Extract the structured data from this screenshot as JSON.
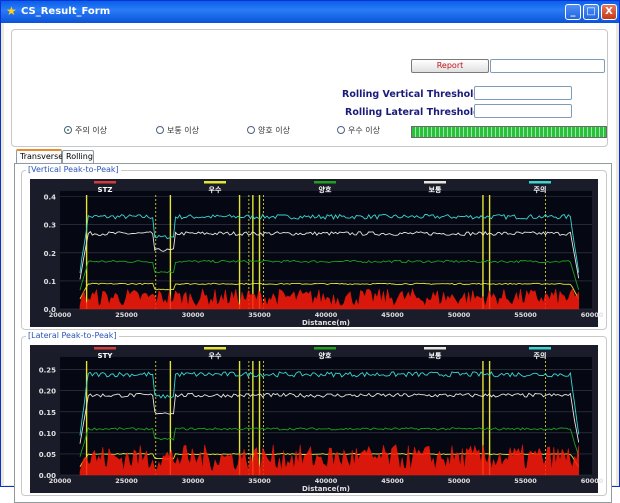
{
  "window": {
    "title": "CS_Result_Form",
    "btn_min": "_",
    "btn_max": "□",
    "btn_close": "X"
  },
  "toolbar": {
    "report_label": "Report"
  },
  "thresholds": {
    "vertical_label": "Rolling Vertical Threshold :",
    "lateral_label": "Rolling Lateral Threshold :"
  },
  "radios": [
    {
      "label": "주의 이상",
      "checked": true
    },
    {
      "label": "보통 이상",
      "checked": false
    },
    {
      "label": "양호 이상",
      "checked": false
    },
    {
      "label": "우수 이상",
      "checked": false
    }
  ],
  "tabs": [
    {
      "label": "Transverse",
      "active": true
    },
    {
      "label": "Rolling",
      "active": false
    }
  ],
  "colors": {
    "plot_bg": "#050712",
    "frame_bg": "#1a1c2a",
    "red": "#ff1a0a",
    "green": "#1fa01f",
    "white": "#e8e6dd",
    "cyan": "#38d6d0",
    "yellow": "#e6e630",
    "legend_red": "#d23c3c",
    "legend_yellow": "#e6e630",
    "legend_green": "#1fa01f",
    "legend_white": "#e8e6dd",
    "legend_cyan": "#38d6d0"
  },
  "chart_data": [
    {
      "type": "line",
      "title": "[Vertical Peak-to-Peak]",
      "xlabel": "Distance(m)",
      "ylabel": "",
      "xlim": [
        20000,
        60000
      ],
      "ylim": [
        0,
        0.42
      ],
      "x_ticks": [
        "20000",
        "25000",
        "30000",
        "35000",
        "40000",
        "45000",
        "50000",
        "55000",
        "60000"
      ],
      "y_ticks": [
        "0.0",
        "0.1",
        "0.2",
        "0.3",
        "0.4"
      ],
      "y_tick_values": [
        0,
        0.1,
        0.2,
        0.3,
        0.4
      ],
      "legend": [
        "STZ",
        "우수",
        "양호",
        "보통",
        "주의"
      ],
      "series": [
        {
          "name": "주의",
          "level": 0.33
        },
        {
          "name": "보통",
          "level": 0.27
        },
        {
          "name": "양호",
          "level": 0.17
        },
        {
          "name": "우수",
          "level": 0.09
        },
        {
          "name": "STZ",
          "level": 0.04
        }
      ]
    },
    {
      "type": "line",
      "title": "[Lateral Peak-to-Peak]",
      "xlabel": "Distance(m)",
      "ylabel": "",
      "xlim": [
        20000,
        60000
      ],
      "ylim": [
        0,
        0.28
      ],
      "x_ticks": [
        "20000",
        "25000",
        "30000",
        "35000",
        "40000",
        "45000",
        "50000",
        "55000",
        "60000"
      ],
      "y_ticks": [
        "0.00",
        "0.05",
        "0.10",
        "0.15",
        "0.20",
        "0.25"
      ],
      "y_tick_values": [
        0,
        0.05,
        0.1,
        0.15,
        0.2,
        0.25
      ],
      "legend": [
        "STY",
        "우수",
        "양호",
        "보통",
        "주의"
      ],
      "series": [
        {
          "name": "주의",
          "level": 0.24
        },
        {
          "name": "보통",
          "level": 0.19
        },
        {
          "name": "양호",
          "level": 0.11
        },
        {
          "name": "우수",
          "level": 0.05
        },
        {
          "name": "STY",
          "level": 0.04
        }
      ]
    }
  ]
}
